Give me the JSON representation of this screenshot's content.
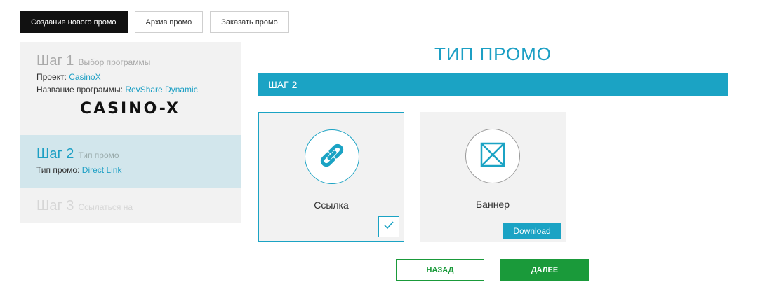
{
  "tabs": [
    {
      "label": "Создание нового промо",
      "active": true
    },
    {
      "label": "Архив промо",
      "active": false
    },
    {
      "label": "Заказать промо",
      "active": false
    }
  ],
  "sidebar": {
    "step1": {
      "num": "Шаг 1",
      "sub": "Выбор программы",
      "project_label": "Проект:",
      "project_value": "CasinoX",
      "program_label": "Название программы:",
      "program_value": "RevShare Dynamic",
      "logo_text": "CASINO-X"
    },
    "step2": {
      "num": "Шаг 2",
      "sub": "Тип промо",
      "type_label": "Тип промо:",
      "type_value": "Direct Link"
    },
    "step3": {
      "num": "Шаг 3",
      "sub": "Ссылаться на"
    }
  },
  "main": {
    "title": "ТИП ПРОМО",
    "step_bar": "ШАГ 2",
    "cards": [
      {
        "label": "Ссылка",
        "icon": "link-icon",
        "selected": true
      },
      {
        "label": "Баннер",
        "icon": "image-placeholder-icon",
        "selected": false,
        "button": "Download"
      }
    ],
    "back_label": "НАЗАД",
    "next_label": "ДАЛЕЕ"
  },
  "colors": {
    "accent": "#1ba3c4",
    "green": "#1a9a3a",
    "dark": "#111111",
    "sidebar_bg": "#f2f2f2",
    "active_step_bg": "#d2e6ec"
  }
}
